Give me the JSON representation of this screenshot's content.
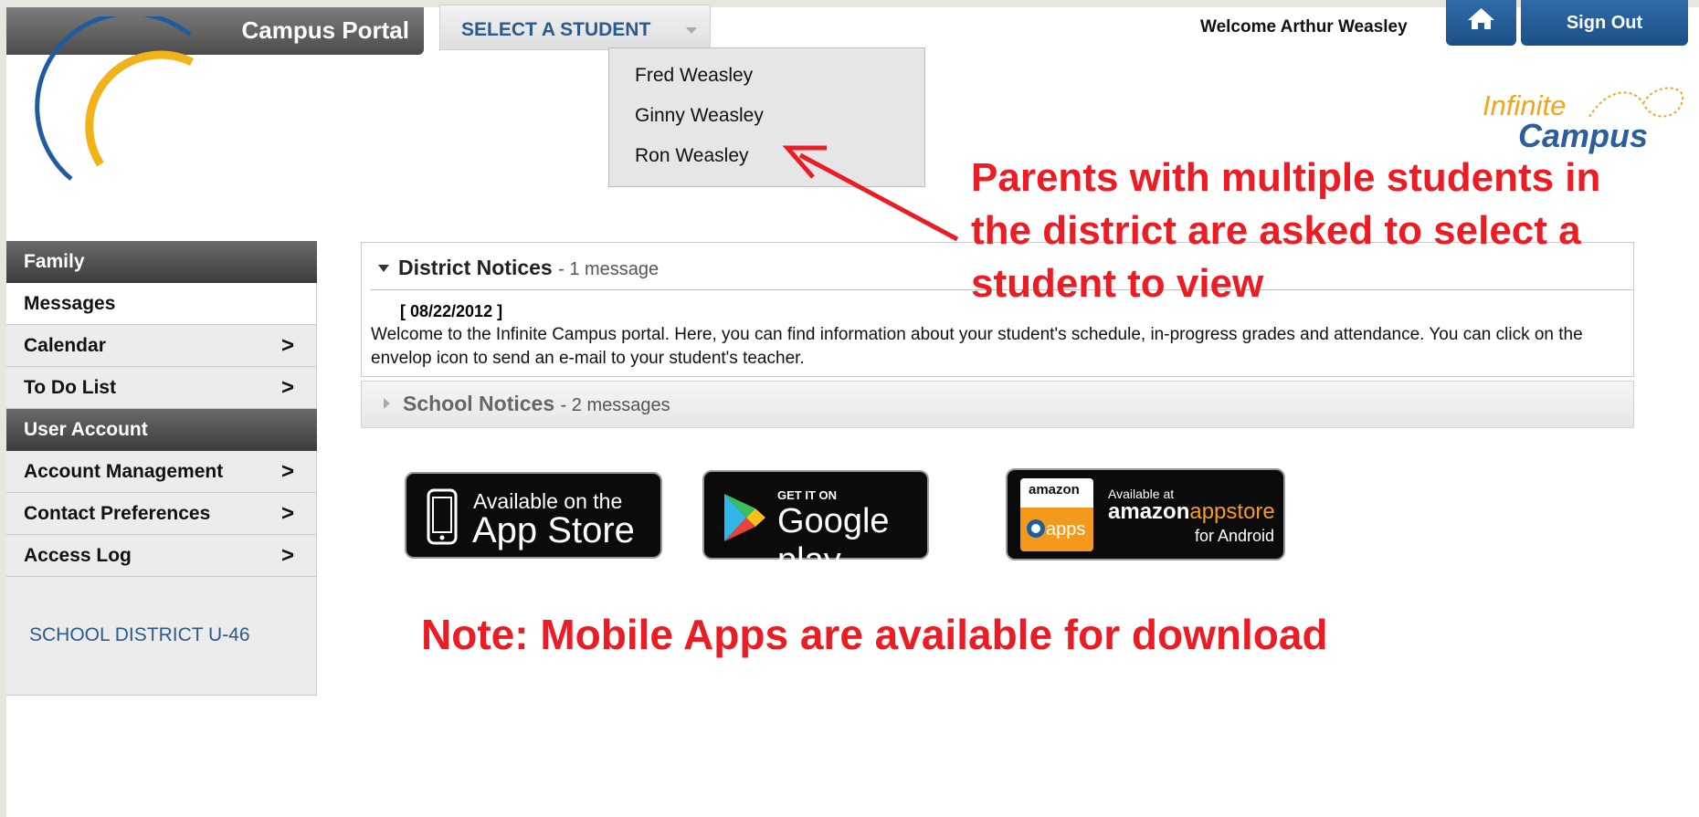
{
  "header": {
    "portal_title": "Campus Portal",
    "select_student_label": "SELECT A STUDENT",
    "welcome_text": "Welcome Arthur Weasley",
    "sign_out_label": "Sign Out",
    "home_icon": "home-icon"
  },
  "student_dropdown": {
    "options": [
      "Fred Weasley",
      "Ginny Weasley",
      "Ron Weasley"
    ]
  },
  "brand": {
    "logo_line1": "Infinite",
    "logo_line2": "Campus",
    "accent_blue": "#2b5e9b",
    "accent_gold": "#f2a51a"
  },
  "sidebar": {
    "section_family": "Family",
    "messages": "Messages",
    "calendar": "Calendar",
    "todo": "To Do List",
    "section_account": "User Account",
    "account_management": "Account Management",
    "contact_preferences": "Contact Preferences",
    "access_log": "Access Log",
    "chevron": ">",
    "district": "SCHOOL DISTRICT U-46"
  },
  "notices": {
    "district_title": "District Notices",
    "district_count": "- 1 message",
    "date": "[ 08/22/2012 ]",
    "message": "Welcome to the Infinite Campus portal. Here, you can find information about your student's schedule, in-progress grades and attendance. You can click on the envelop icon to send an e-mail to your student's teacher.",
    "school_title": "School Notices",
    "school_count": "- 2 messages"
  },
  "apps": {
    "apple_line1": "Available on the",
    "apple_line2": "App Store",
    "google_line1": "GET IT ON",
    "google_line2": "Google play",
    "amazon_box_top": "amazon",
    "amazon_box_bottom": "apps",
    "amazon_line1": "Available at",
    "amazon_line2a": "amazon",
    "amazon_line2b": "appstore",
    "amazon_line3": "for Android"
  },
  "annotations": {
    "multi_student": "Parents with multiple students in the district are asked to select a student to view",
    "mobile_note": "Note: Mobile Apps are available for download",
    "color": "#ec1c24"
  }
}
